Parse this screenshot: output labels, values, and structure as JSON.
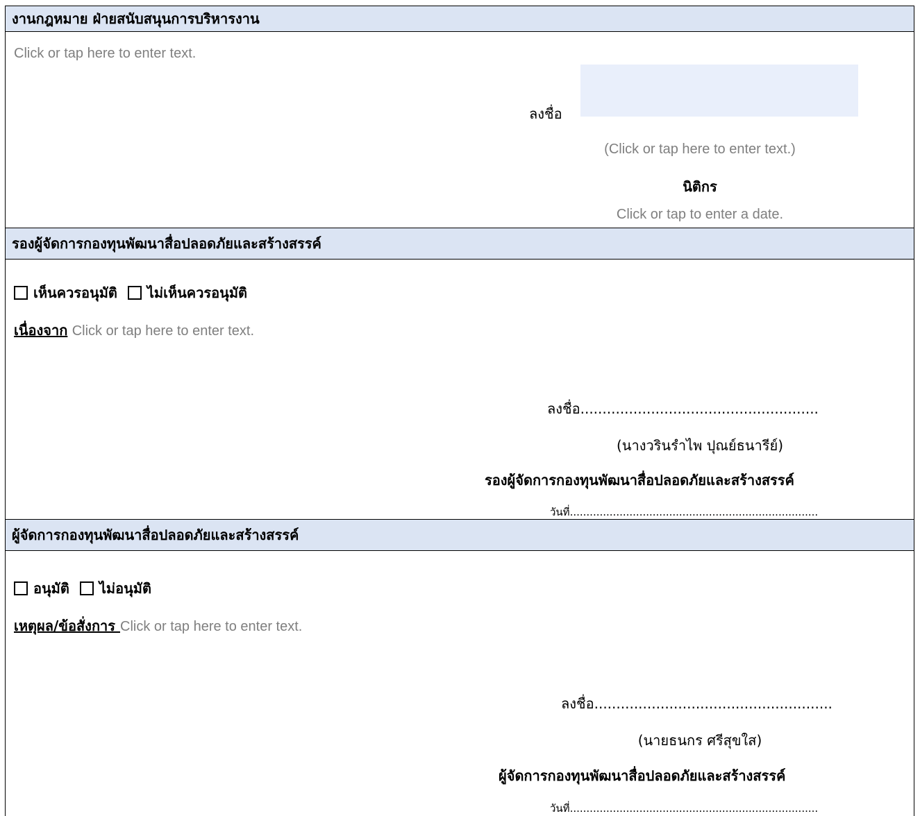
{
  "section1": {
    "header": "งานกฎหมาย ฝ่ายสนับสนุนการบริหารงาน",
    "text_placeholder": "Click or tap here to enter text.",
    "sign_label": "ลงชื่อ",
    "name_placeholder": "(Click or tap here to enter text.)",
    "position": "นิติกร",
    "date_placeholder": "Click or tap to enter a date."
  },
  "section2": {
    "header": "รองผู้จัดการกองทุนพัฒนาสื่อปลอดภัยและสร้างสรรค์",
    "option_approve": "เห็นควรอนุมัติ",
    "option_reject": "ไม่เห็นควรอนุมัติ",
    "reason_label": "เนื่องจาก",
    "reason_placeholder": "Click or tap here to enter text.",
    "sign_line": "ลงชื่อ......................................................",
    "name": "(นางวรินรำไพ  ปุณย์ธนารีย์)",
    "position": "รองผู้จัดการกองทุนพัฒนาสื่อปลอดภัยและสร้างสรรค์",
    "date_line": "วันที่..........................................................................."
  },
  "section3": {
    "header": "ผู้จัดการกองทุนพัฒนาสื่อปลอดภัยและสร้างสรรค์",
    "option_approve": "อนุมัติ",
    "option_reject": "ไม่อนุมัติ",
    "reason_label": "เหตุผล/ข้อสั่งการ ",
    "reason_placeholder": "Click or tap here to enter text.",
    "sign_line": "ลงชื่อ......................................................",
    "name": "(นายธนกร  ศรีสุขใส)",
    "position": "ผู้จัดการกองทุนพัฒนาสื่อปลอดภัยและสร้างสรรค์",
    "date_line": "วันที่..........................................................................."
  }
}
